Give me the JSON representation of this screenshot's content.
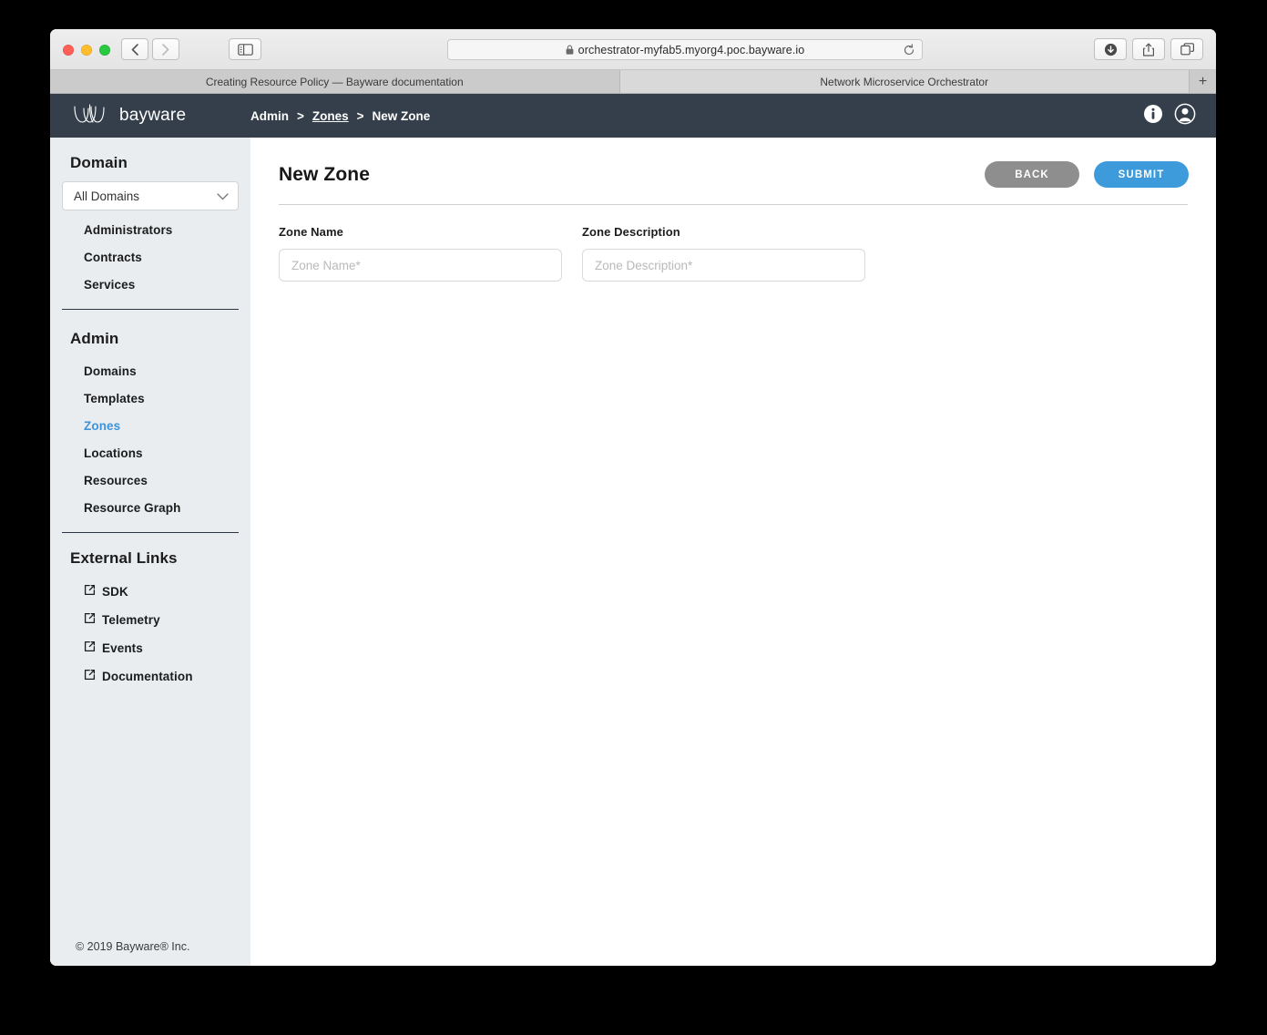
{
  "browser": {
    "url": "orchestrator-myfab5.myorg4.poc.bayware.io",
    "tabs": [
      {
        "title": "Creating Resource Policy — Bayware documentation",
        "active": false
      },
      {
        "title": "Network Microservice Orchestrator",
        "active": true
      }
    ],
    "new_tab_label": "+",
    "controls": {
      "back": "back-icon",
      "forward": "forward-icon",
      "sidebar": "sidebar-toggle-icon",
      "reload": "reload-icon",
      "downloads": "downloads-icon",
      "share": "share-icon",
      "tab-overview": "tab-overview-icon"
    }
  },
  "app": {
    "logo_text": "bayware",
    "breadcrumb": {
      "root": "Admin",
      "separator": ">",
      "link": "Zones",
      "current": "New Zone"
    },
    "header_icons": {
      "info": "info-icon",
      "account": "account-icon"
    }
  },
  "sidebar": {
    "domain_heading": "Domain",
    "domain_select": {
      "value": "All Domains"
    },
    "domain_items": [
      {
        "label": "Administrators",
        "active": false
      },
      {
        "label": "Contracts",
        "active": false
      },
      {
        "label": "Services",
        "active": false
      }
    ],
    "admin_heading": "Admin",
    "admin_items": [
      {
        "label": "Domains",
        "active": false
      },
      {
        "label": "Templates",
        "active": false
      },
      {
        "label": "Zones",
        "active": true
      },
      {
        "label": "Locations",
        "active": false
      },
      {
        "label": "Resources",
        "active": false
      },
      {
        "label": "Resource Graph",
        "active": false
      }
    ],
    "external_heading": "External Links",
    "external_items": [
      {
        "label": "SDK"
      },
      {
        "label": "Telemetry"
      },
      {
        "label": "Events"
      },
      {
        "label": "Documentation"
      }
    ],
    "footer": "© 2019 Bayware® Inc."
  },
  "main": {
    "title": "New Zone",
    "back_label": "BACK",
    "submit_label": "SUBMIT",
    "fields": [
      {
        "label": "Zone Name",
        "placeholder": "Zone Name*",
        "value": ""
      },
      {
        "label": "Zone Description",
        "placeholder": "Zone Description*",
        "value": ""
      }
    ]
  },
  "colors": {
    "header_bg": "#343f4b",
    "sidebar_bg": "#e9edf0",
    "accent_blue": "#3d9bdc",
    "back_grey": "#8e8e8e"
  }
}
